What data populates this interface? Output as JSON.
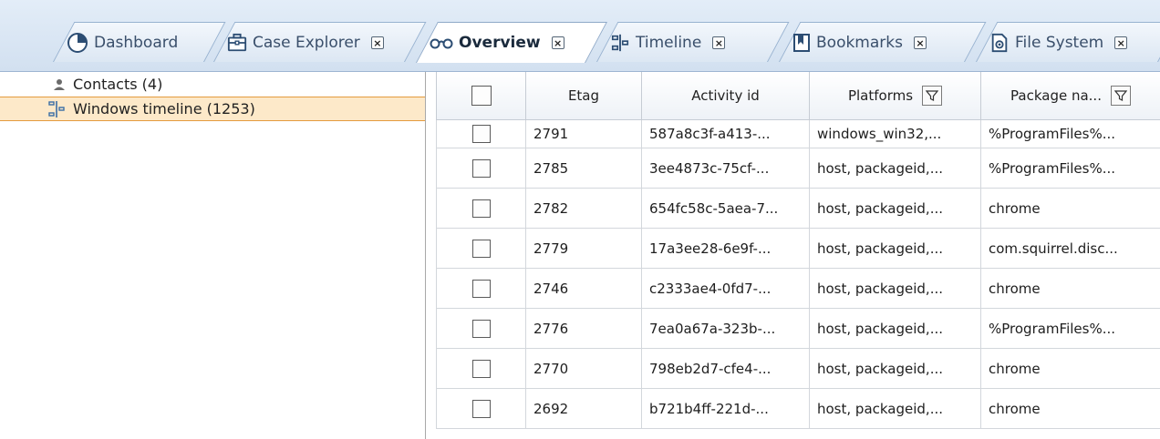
{
  "tabs": [
    {
      "label": "Dashboard",
      "icon": "pie-chart-icon",
      "closable": false,
      "active": false
    },
    {
      "label": "Case Explorer",
      "icon": "briefcase-icon",
      "closable": true,
      "active": false
    },
    {
      "label": "Overview",
      "icon": "glasses-icon",
      "closable": true,
      "active": true
    },
    {
      "label": "Timeline",
      "icon": "timeline-icon",
      "closable": true,
      "active": false
    },
    {
      "label": "Bookmarks",
      "icon": "bookmark-icon",
      "closable": true,
      "active": false
    },
    {
      "label": "File System",
      "icon": "file-system-icon",
      "closable": true,
      "active": false
    }
  ],
  "close_glyph": "×",
  "tree": {
    "items": [
      {
        "label": "Contacts (4)",
        "icon": "contact-icon",
        "selected": false
      },
      {
        "label": "Windows timeline (1253)",
        "icon": "windows-timeline-icon",
        "selected": true
      }
    ]
  },
  "grid": {
    "columns": [
      "",
      "Etag",
      "Activity id",
      "Platforms",
      "Package na..."
    ],
    "rows": [
      [
        "2791",
        "587a8c3f-a413-...",
        "windows_win32,...",
        "%ProgramFiles%..."
      ],
      [
        "2785",
        "3ee4873c-75cf-...",
        "host, packageid,...",
        "%ProgramFiles%..."
      ],
      [
        "2782",
        "654fc58c-5aea-7...",
        "host, packageid,...",
        "chrome"
      ],
      [
        "2779",
        "17a3ee28-6e9f-...",
        "host, packageid,...",
        "com.squirrel.disc..."
      ],
      [
        "2746",
        "c2333ae4-0fd7-...",
        "host, packageid,...",
        "chrome"
      ],
      [
        "2776",
        "7ea0a67a-323b-...",
        "host, packageid,...",
        "%ProgramFiles%..."
      ],
      [
        "2770",
        "798eb2d7-cfe4-...",
        "host, packageid,...",
        "chrome"
      ],
      [
        "2692",
        "b721b4ff-221d-...",
        "host, packageid,...",
        "chrome"
      ]
    ]
  },
  "colors": {
    "accent": "#3b6ea5",
    "selection_bg": "#fde9c9",
    "selection_border": "#e49b3e"
  }
}
